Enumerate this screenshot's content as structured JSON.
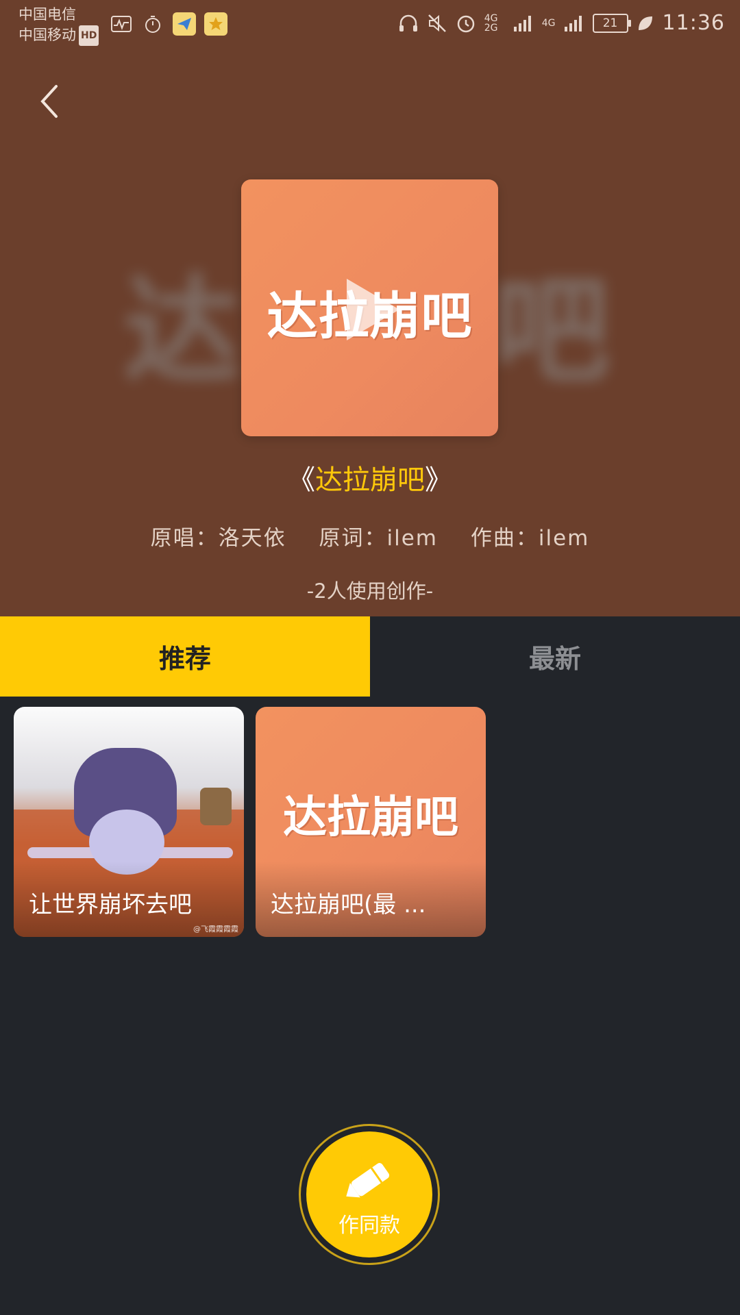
{
  "status_bar": {
    "carrier_line1": "中国电信",
    "carrier_line2": "中国移动",
    "hd_badge": "HD",
    "network_1": "4G 2G",
    "network_2": "4G",
    "battery_level": "21",
    "time": "11:36",
    "left_icons": [
      "activity-icon",
      "timer-icon",
      "paper-plane-app-icon",
      "star-app-icon"
    ],
    "right_icons": [
      "headphones-icon",
      "mute-icon",
      "alarm-icon",
      "signal-icon",
      "signal-icon",
      "battery-icon",
      "leaf-icon"
    ]
  },
  "header": {
    "background_word": "达拉崩吧",
    "cover_text": "达拉崩吧",
    "title_open": "《",
    "title_name": "达拉崩吧",
    "title_close": "》",
    "credits": {
      "singer": "原唱：洛天依",
      "lyricist": "原词：ilem",
      "composer": "作曲：ilem"
    },
    "usage": "-2人使用创作-"
  },
  "tabs": [
    {
      "label": "推荐",
      "active": true
    },
    {
      "label": "最新",
      "active": false
    }
  ],
  "works": [
    {
      "title": "让世界崩坏去吧",
      "watermark": "@飞霞霞霞霞"
    },
    {
      "title": "达拉崩吧(最 ...",
      "cover_text": "达拉崩吧"
    }
  ],
  "fab": {
    "label": "作同款"
  },
  "colors": {
    "header_bg": "#6b3f2c",
    "accent_yellow": "#ffca05",
    "cover_orange": "#ef8b5f",
    "page_bg": "#22252a"
  }
}
